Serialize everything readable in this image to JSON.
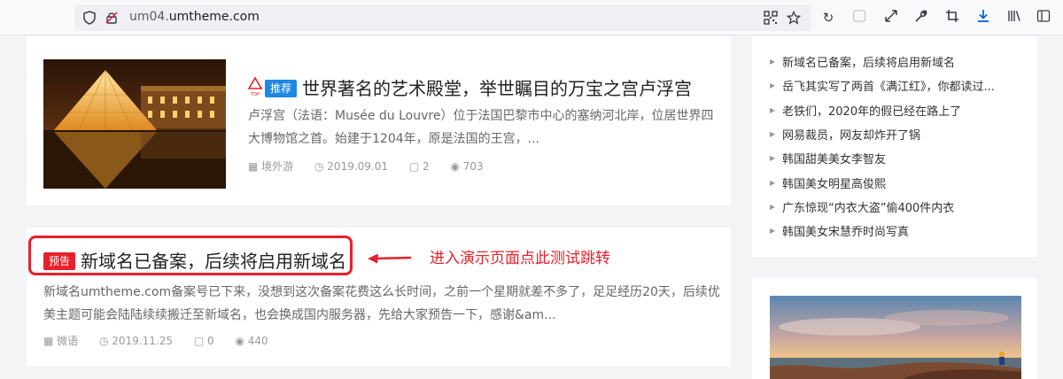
{
  "browser": {
    "url_host": "um04.",
    "url_domain": "umtheme.com"
  },
  "articles": [
    {
      "top_badge": "TOP",
      "tag": "推荐",
      "tag_color": "#1e88e5",
      "title": "世界著名的艺术殿堂，举世瞩目的万宝之宫卢浮宫",
      "excerpt": "卢浮宫（法语：Musée du Louvre）位于法国巴黎市中心的塞纳河北岸，位居世界四大博物馆之首。始建于1204年，原是法国的王宫，...",
      "category": "境外游",
      "date": "2019.09.01",
      "comments": "2",
      "views": "703"
    },
    {
      "tag": "预告",
      "tag_color": "#e8202a",
      "title": "新域名已备案，后续将启用新域名",
      "excerpt": "新域名umtheme.com备案号已下来，没想到这次备案花费这么长时间，之前一个星期就差不多了，足足经历20天，后续优美主题可能会陆陆续续搬迁至新域名，也会换成国内服务器，先给大家预告一下，感谢&am...",
      "category": "微语",
      "date": "2019.11.25",
      "comments": "0",
      "views": "440"
    }
  ],
  "annotation": "进入演示页面点此测试跳转",
  "sidebar": {
    "items": [
      "新域名已备案，后续将启用新域名",
      "岳飞其实写了两首《满江红》，你都读过...",
      "老铁们，2020年的假已经在路上了",
      "网易裁员，网友却炸开了锅",
      "韩国甜美美女李智友",
      "韩国美女明星高俊熙",
      "广东惊现“内衣大盗”偷400件内衣",
      "韩国美女宋慧乔时尚写真"
    ]
  }
}
